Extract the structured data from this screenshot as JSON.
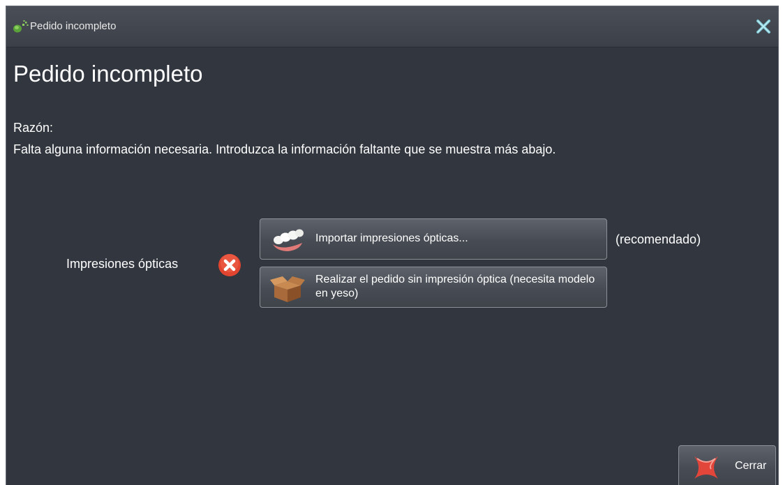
{
  "window": {
    "title": "Pedido incompleto",
    "icons": {
      "app": "dental-app-icon",
      "close": "close-icon"
    }
  },
  "main": {
    "heading": "Pedido incompleto",
    "reason_label": "Razón:",
    "reason_text": "Falta alguna información necesaria. Introduzca la información faltante que se muestra más abajo."
  },
  "optical_impressions": {
    "label": "Impresiones ópticas",
    "status_icon": "error-icon",
    "import_button": {
      "label": "Importar impresiones ópticas...",
      "icon": "teeth-icon"
    },
    "recommended_note": "(recomendado)",
    "no_impression_button": {
      "label": "Realizar el pedido sin impresión óptica (necesita modelo en yeso)",
      "icon": "box-icon"
    }
  },
  "footer": {
    "close_button_label": "Cerrar",
    "close_button_icon": "cancel-icon"
  },
  "colors": {
    "background": "#32363f",
    "error": "#e2452f",
    "accent_green": "#7ab648"
  }
}
